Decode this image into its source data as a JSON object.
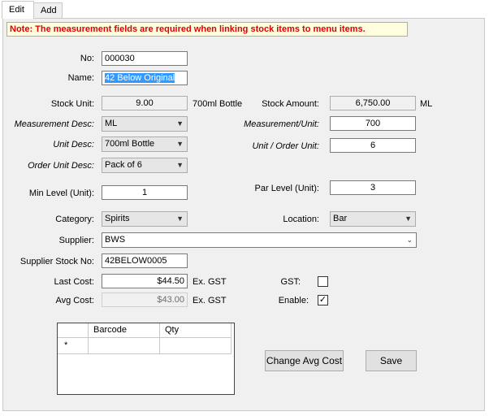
{
  "tabs": [
    {
      "label": "Edit"
    },
    {
      "label": "Add"
    }
  ],
  "note": "Note: The measurement fields are required when linking stock items to menu items.",
  "fields": {
    "no": {
      "label": "No:",
      "value": "000030"
    },
    "name": {
      "label": "Name:",
      "value": "42 Below Original"
    },
    "stock_unit": {
      "label": "Stock Unit:",
      "value": "9.00",
      "suffix": "700ml Bottle"
    },
    "stock_amount": {
      "label": "Stock Amount:",
      "value": "6,750.00",
      "suffix": "ML"
    },
    "measurement_desc": {
      "label": "Measurement Desc:",
      "value": "ML"
    },
    "measurement_unit": {
      "label": "Measurement/Unit:",
      "value": "700"
    },
    "unit_desc": {
      "label": "Unit Desc:",
      "value": "700ml Bottle"
    },
    "unit_order_unit": {
      "label": "Unit / Order Unit:",
      "value": "6"
    },
    "order_unit_desc": {
      "label": "Order Unit Desc:",
      "value": "Pack of 6"
    },
    "min_level": {
      "label": "Min Level (Unit):",
      "value": "1"
    },
    "par_level": {
      "label": "Par Level (Unit):",
      "value": "3"
    },
    "category": {
      "label": "Category:",
      "value": "Spirits"
    },
    "location": {
      "label": "Location:",
      "value": "Bar"
    },
    "supplier": {
      "label": "Supplier:",
      "value": "BWS"
    },
    "supplier_stock_no": {
      "label": "Supplier Stock No:",
      "value": "42BELOW0005"
    },
    "last_cost": {
      "label": "Last Cost:",
      "value": "$44.50",
      "suffix": "Ex. GST"
    },
    "avg_cost": {
      "label": "Avg Cost:",
      "value": "$43.00",
      "suffix": "Ex. GST"
    },
    "gst": {
      "label": "GST:",
      "checked": false
    },
    "enable": {
      "label": "Enable:",
      "checked": true,
      "mark": "✓"
    }
  },
  "grid": {
    "columns": [
      "Barcode",
      "Qty"
    ],
    "new_row_marker": "*"
  },
  "buttons": {
    "change_avg_cost": "Change Avg Cost",
    "save": "Save"
  }
}
